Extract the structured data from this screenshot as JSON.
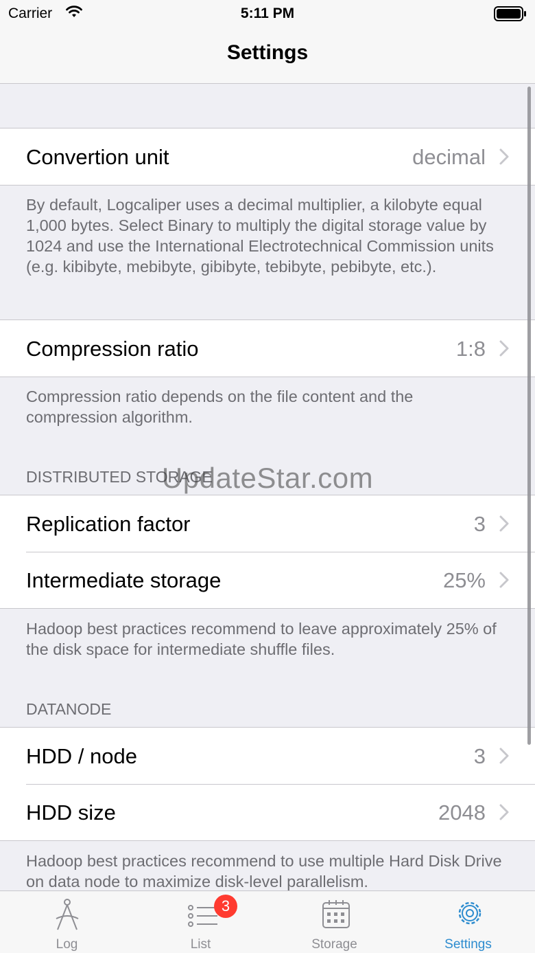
{
  "status_bar": {
    "carrier": "Carrier",
    "time": "5:11 PM"
  },
  "nav": {
    "title": "Settings"
  },
  "sections": {
    "unit": {
      "label": "Convertion unit",
      "value": "decimal",
      "footer": "By default, Logcaliper uses a decimal multiplier, a kilobyte equal 1,000 bytes. Select Binary to multiply the digital storage value by 1024 and use the International Electrotechnical Commission units (e.g. kibibyte, mebibyte, gibibyte, tebibyte, pebibyte, etc.)."
    },
    "compression": {
      "label": "Compression ratio",
      "value": "1:8",
      "footer": "Compression ratio depends on the file content and the compression algorithm."
    },
    "distributed": {
      "header": "DISTRIBUTED STORAGE",
      "rows": [
        {
          "label": "Replication factor",
          "value": "3"
        },
        {
          "label": "Intermediate storage",
          "value": "25%"
        }
      ],
      "footer": "Hadoop best practices recommend to leave approximately 25% of the disk space for intermediate shuffle files."
    },
    "datanode": {
      "header": "DATANODE",
      "rows": [
        {
          "label": "HDD / node",
          "value": "3"
        },
        {
          "label": "HDD size",
          "value": "2048"
        }
      ],
      "footer": "Hadoop best practices recommend to use multiple Hard Disk Drive on data node to maximize disk-level parallelism."
    }
  },
  "watermark": "UpdateStar.com",
  "tab_bar": {
    "tabs": [
      {
        "label": "Log",
        "icon": "caliper-icon"
      },
      {
        "label": "List",
        "icon": "list-icon",
        "badge": "3"
      },
      {
        "label": "Storage",
        "icon": "calendar-icon"
      },
      {
        "label": "Settings",
        "icon": "gear-icon"
      }
    ],
    "active": "Settings",
    "active_color": "#2d8ccf",
    "inactive_color": "#8e8e93"
  }
}
